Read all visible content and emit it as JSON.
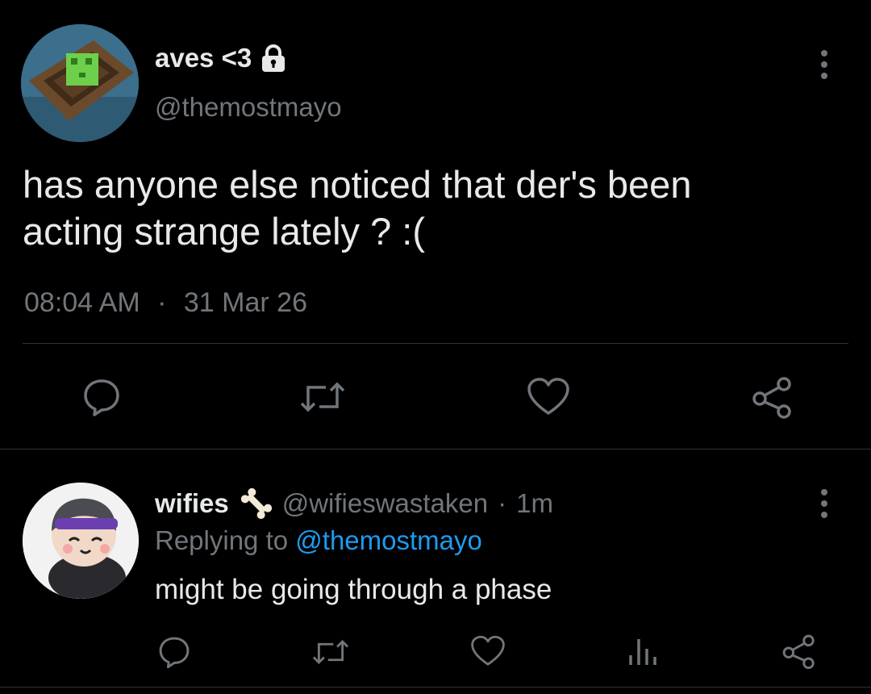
{
  "main_tweet": {
    "display_name": "aves <3",
    "handle": "@themostmayo",
    "text_line1": "has anyone else noticed that der's been",
    "text_line2": "acting strange lately ? :(",
    "time": "08:04 AM",
    "separator": "·",
    "date": "31 Mar 26",
    "icons": {
      "protected": "lock-icon",
      "more": "more-vertical-icon",
      "reply": "reply-icon",
      "retweet": "retweet-icon",
      "like": "heart-icon",
      "share": "share-icon"
    }
  },
  "reply_tweet": {
    "display_name": "wifies",
    "emoji": "bone-icon",
    "handle": "@wifieswastaken",
    "separator": "·",
    "age": "1m",
    "replying_prefix": "Replying to",
    "replying_handle": "@themostmayo",
    "text": "might be going through a phase",
    "icons": {
      "more": "more-vertical-icon",
      "reply": "reply-icon",
      "retweet": "retweet-icon",
      "like": "heart-icon",
      "views": "analytics-icon",
      "share": "share-icon"
    }
  },
  "colors": {
    "background": "#000000",
    "text": "#e7e9ea",
    "muted": "#71767b",
    "link": "#1d9bf0",
    "divider": "#2f3336"
  }
}
